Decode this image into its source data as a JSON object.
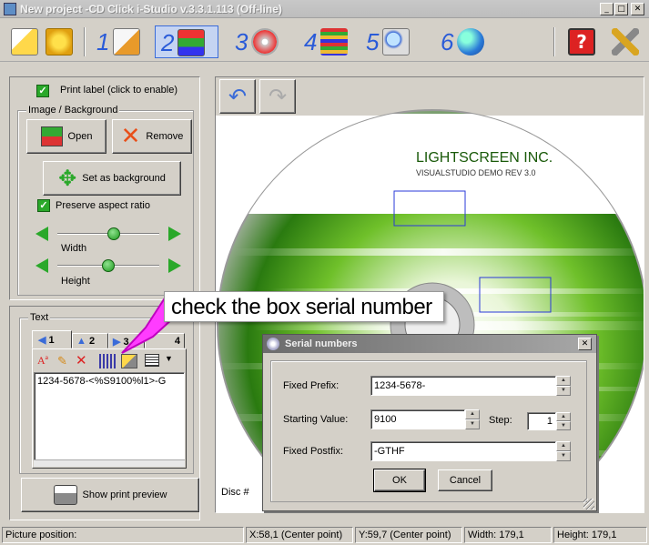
{
  "window": {
    "title": "New project -CD Click i-Studio v.3.3.1.113 (Off-line)",
    "min": "_",
    "max": "□",
    "close": "✕"
  },
  "toolbar": {
    "steps": [
      "1",
      "2",
      "3",
      "4",
      "5",
      "6"
    ]
  },
  "left": {
    "print_label": "Print label (click to enable)",
    "image_group": "Image / Background",
    "open": "Open",
    "remove": "Remove",
    "set_bg": "Set as background",
    "preserve": "Preserve aspect ratio",
    "width": "Width",
    "height": "Height",
    "width_value": 0.55,
    "height_value": 0.5,
    "text_group": "Text",
    "tabs": [
      "1",
      "2",
      "3",
      "4"
    ],
    "text_content": "1234-5678-<%S9100%l1>-G",
    "show_preview": "Show print preview"
  },
  "canvas": {
    "company": "LIGHTSCREEN INC.",
    "sub": "VISUALSTUDIO DEMO REV 3.0",
    "disc_label": "Disc #"
  },
  "callout": "check the box serial number",
  "dialog": {
    "title": "Serial numbers",
    "prefix_label": "Fixed Prefix:",
    "prefix_value": "1234-5678-",
    "start_label": "Starting Value:",
    "start_value": "9100",
    "step_label": "Step:",
    "step_value": "1",
    "postfix_label": "Fixed Postfix:",
    "postfix_value": "-GTHF",
    "ok": "OK",
    "cancel": "Cancel"
  },
  "status": {
    "position": "Picture position:",
    "x": "X:58,1 (Center point)",
    "y": "Y:59,7 (Center point)",
    "w": "Width: 179,1",
    "h": "Height: 179,1"
  },
  "colors": {
    "accent": "#2a5bd8",
    "green": "#2aa82a",
    "callout_arrow": "#ff3cff"
  }
}
